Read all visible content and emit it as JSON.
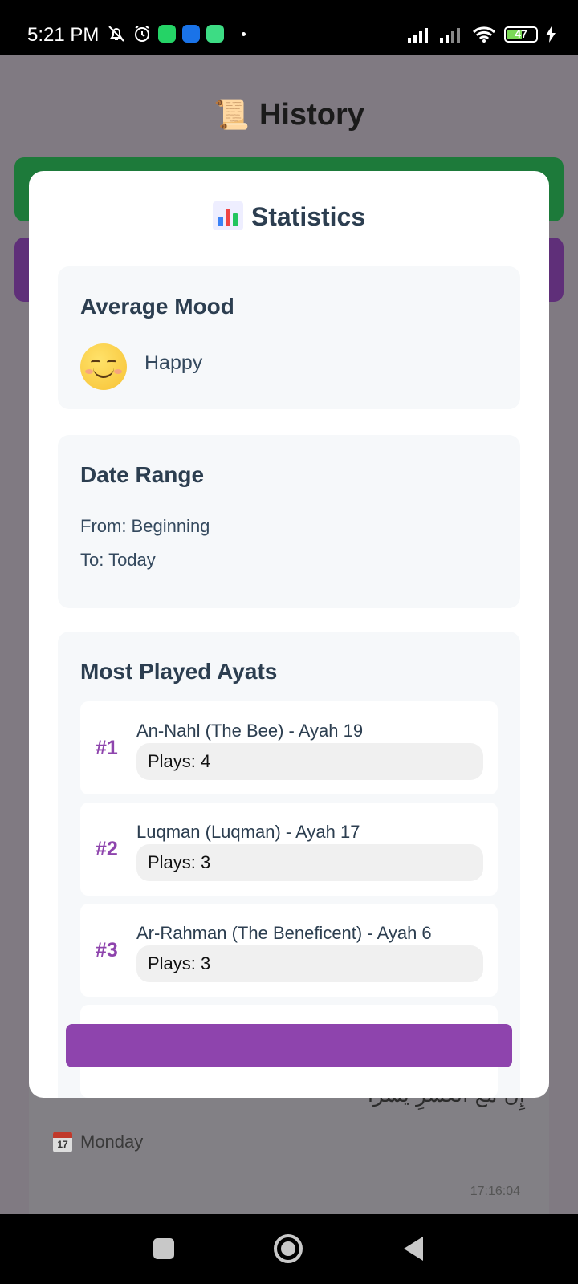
{
  "status_bar": {
    "time": "5:21 PM",
    "battery": "47"
  },
  "background": {
    "title": "History",
    "title_emoji": "📜",
    "arabic_verse": "إِنَّ مَعَ الْعُسْرِ يُسْرًا",
    "day": "Monday",
    "calendar_day": "17",
    "timestamp": "17:16:04"
  },
  "modal": {
    "title": "Statistics",
    "mood": {
      "heading": "Average Mood",
      "value": "Happy"
    },
    "date_range": {
      "heading": "Date Range",
      "from": "From: Beginning",
      "to": "To: Today"
    },
    "most_played": {
      "heading": "Most Played Ayats",
      "items": [
        {
          "rank": "#1",
          "name": "An-Nahl (The Bee) - Ayah 19",
          "plays": "Plays: 4"
        },
        {
          "rank": "#2",
          "name": "Luqman (Luqman) - Ayah 17",
          "plays": "Plays: 3"
        },
        {
          "rank": "#3",
          "name": "Ar-Rahman (The Beneficent) - Ayah 6",
          "plays": "Plays: 3"
        }
      ]
    }
  },
  "colors": {
    "accent_purple": "#8e44ad",
    "green_card": "#1d7a3a",
    "purple_card": "#5f2f79"
  }
}
